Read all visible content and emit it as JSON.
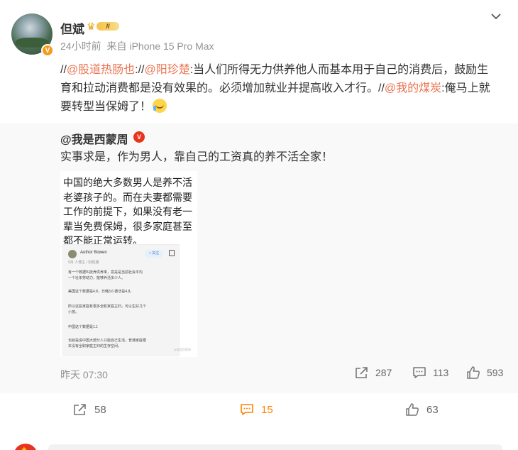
{
  "author": {
    "name": "但斌",
    "level_badge": "II",
    "time": "24小时前",
    "source_prefix": "来自",
    "device": "iPhone 15 Pro Max"
  },
  "post": {
    "seg1_prefix": "//",
    "seg1_at": "@股道热肠也",
    "seg2_prefix": "://",
    "seg2_at": "@阳珍楚",
    "seg2_text": ":当人们所得无力供养他人而基本用于自己的消费后，鼓励生育和拉动消费都是没有效果的。必须增加就业并提高收入才行。",
    "seg3_prefix": "//",
    "seg3_at": "@我的煤炭",
    "seg3_text": ":俺马上就要转型当保姆了！"
  },
  "repost": {
    "user": "@我是西蒙周",
    "text": "实事求是，作为男人，靠自己的工资真的养不活全家！",
    "image": {
      "big_text": "中国的绝大多数男人是养不活老婆孩子的。而在夫妻都需要工作的前提下，如果没有老一辈当免费保姆，很多家庭甚至都不能正常运转。",
      "mini_name": "Author Bowen",
      "mini_follow": "+ 关注",
      "mini_lines": [
        "9月 人博主 / 财经播",
        "有一个数据叫抚养供养率，意是是当前社会平均",
        "一个壮年劳动力，能够养活多少人。",
        "美国这个数据是4.8，日韩3.6 德法是4.8。",
        "所以这些家庭有很多全职家庭主妇，可以生好几个",
        "小孩。",
        "中国这个数据是1.1",
        "也就是说中国大部分人只能自己生活，普通家庭根",
        "本没有全职家庭主妇的生存空间。"
      ],
      "watermark": "@我是西蒙周"
    },
    "time": "昨天 07:30",
    "reposts": "287",
    "comments": "113",
    "likes": "593"
  },
  "actions": {
    "repost": "58",
    "comment": "15",
    "like": "63"
  },
  "colors": {
    "accent": "#ff8200",
    "mention": "#eb7350",
    "repost_bg": "#f9f9f9",
    "muted": "#939393"
  },
  "icons": {
    "more": "chevron-down-icon",
    "repost": "share-icon",
    "comment": "comment-icon",
    "like": "thumbs-up-icon"
  }
}
